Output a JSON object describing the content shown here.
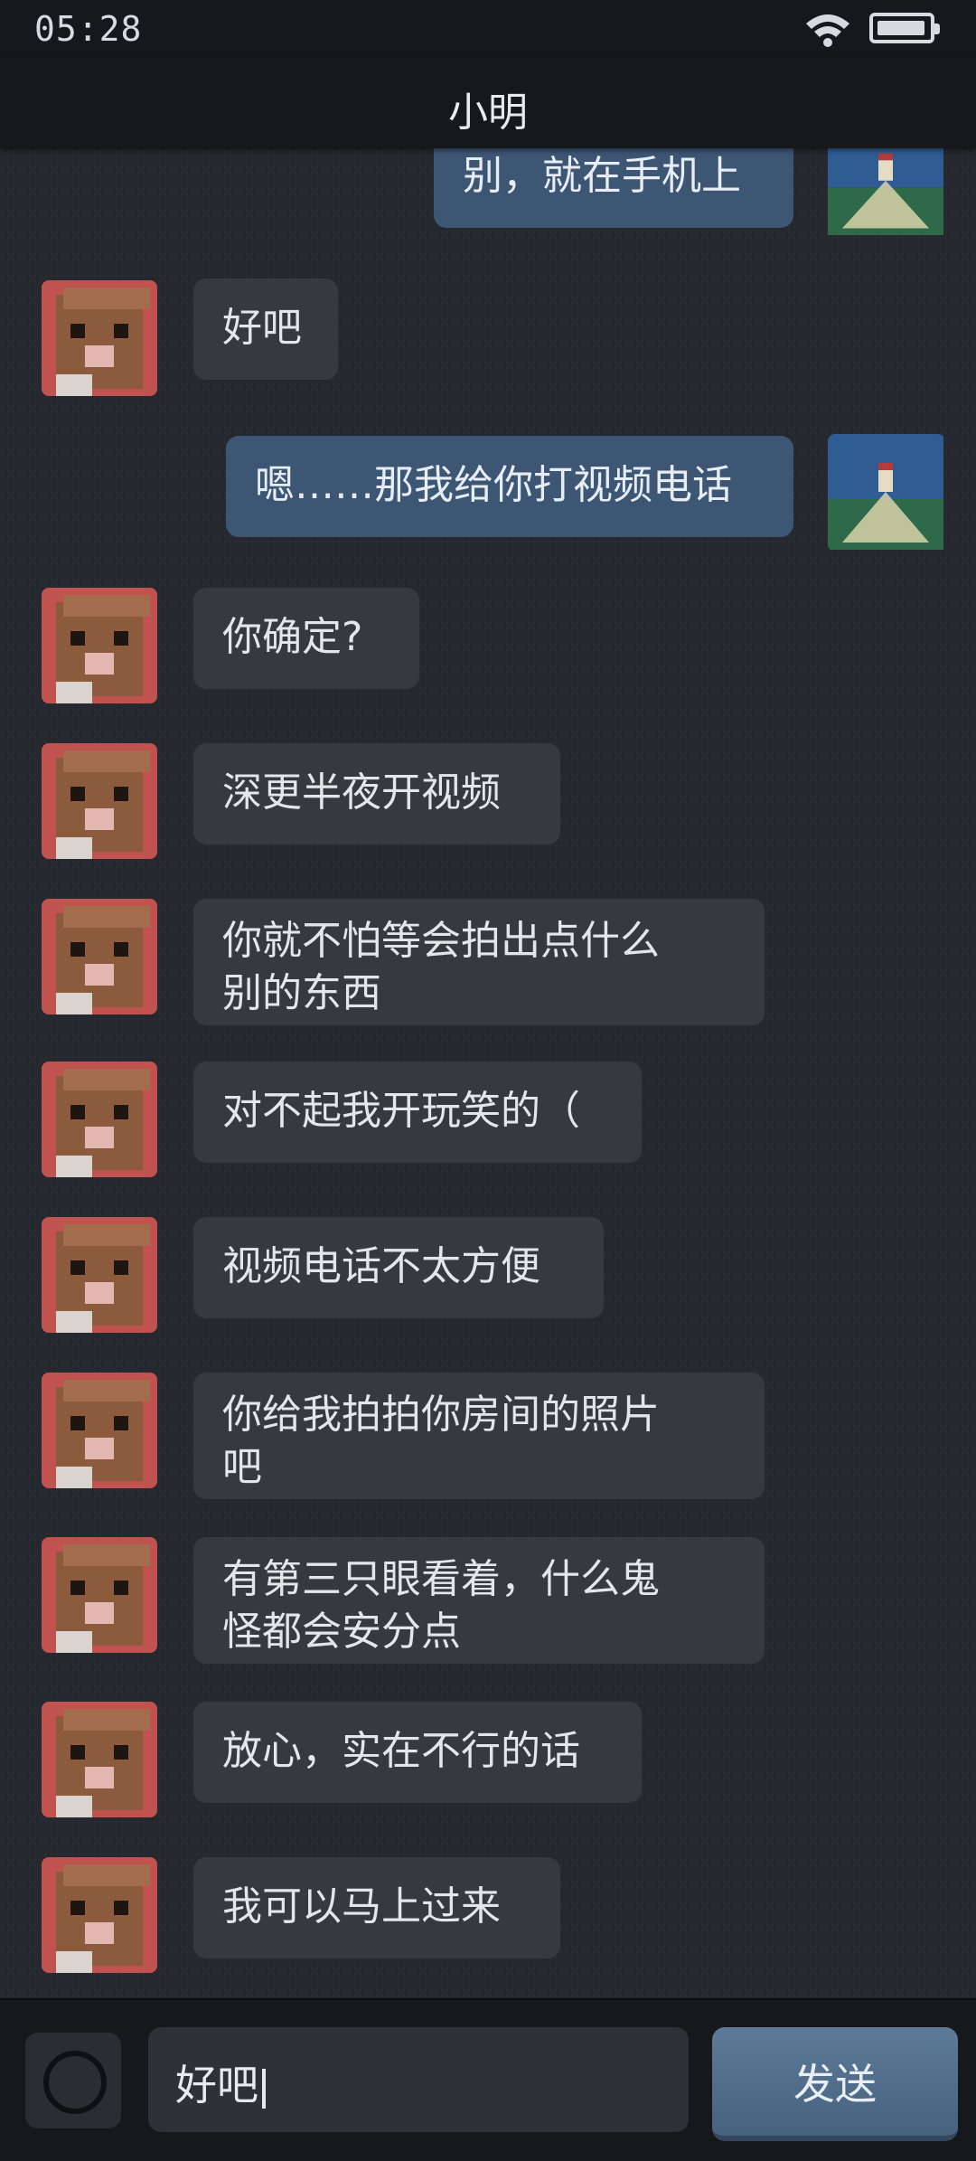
{
  "status_bar": {
    "time": "05:28"
  },
  "header": {
    "title": "小明"
  },
  "messages": [
    {
      "side": "out",
      "text": "别，就在手机上"
    },
    {
      "side": "in",
      "text": "好吧"
    },
    {
      "side": "out",
      "text": "嗯……那我给你打视频电话"
    },
    {
      "side": "in",
      "text": "你确定?"
    },
    {
      "side": "in",
      "text": "深更半夜开视频"
    },
    {
      "side": "in",
      "text": "你就不怕等会拍出点什么\n别的东西"
    },
    {
      "side": "in",
      "text": "对不起我开玩笑的（"
    },
    {
      "side": "in",
      "text": "视频电话不太方便"
    },
    {
      "side": "in",
      "text": "你给我拍拍你房间的照片\n吧"
    },
    {
      "side": "in",
      "text": "有第三只眼看着，什么鬼\n怪都会安分点"
    },
    {
      "side": "in",
      "text": "放心，实在不行的话"
    },
    {
      "side": "in",
      "text": "我可以马上过来"
    }
  ],
  "composer": {
    "input_value": "好吧",
    "send_label": "发送"
  },
  "icons": {
    "wifi": "wifi-icon",
    "battery": "battery-icon",
    "camera": "camera-icon"
  },
  "colors": {
    "bubble_in": "#363940",
    "bubble_out": "#3d5674",
    "background": "#25282f",
    "send_button": "#5d7a98"
  }
}
